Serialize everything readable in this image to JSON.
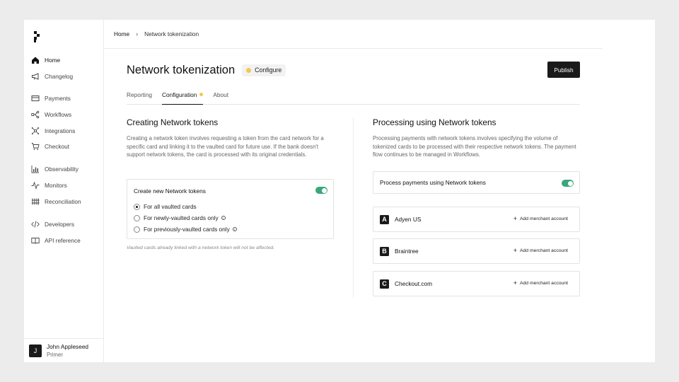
{
  "sidebar": {
    "items": [
      {
        "label": "Home",
        "icon": "home-icon"
      },
      {
        "label": "Changelog",
        "icon": "megaphone-icon"
      },
      {
        "label": "Payments",
        "icon": "card-icon"
      },
      {
        "label": "Workflows",
        "icon": "workflow-icon"
      },
      {
        "label": "Integrations",
        "icon": "integrations-icon"
      },
      {
        "label": "Checkout",
        "icon": "cart-icon"
      },
      {
        "label": "Observability",
        "icon": "bar-chart-icon"
      },
      {
        "label": "Monitors",
        "icon": "pulse-icon"
      },
      {
        "label": "Reconciliation",
        "icon": "reconciliation-icon"
      },
      {
        "label": "Developers",
        "icon": "code-icon"
      },
      {
        "label": "API reference",
        "icon": "book-icon"
      }
    ],
    "user": {
      "initial": "J",
      "name": "John Appleseed",
      "org": "Primer"
    }
  },
  "breadcrumb": {
    "home": "Home",
    "separator": "›",
    "current": "Network tokenization"
  },
  "page": {
    "title": "Network tokenization",
    "badge": "Configure",
    "publish_label": "Publish",
    "tabs": [
      {
        "label": "Reporting"
      },
      {
        "label": "Configuration"
      },
      {
        "label": "About"
      }
    ]
  },
  "creating": {
    "title": "Creating Network tokens",
    "description": "Creating a network token involves requesting a token from the card network for a specific card and linking it to the vaulted card for future use. If the bank doesn't support network tokens, the card is processed with its original credentials.",
    "card_title": "Create new Network tokens",
    "options": [
      {
        "label": "For all vaulted cards",
        "selected": true
      },
      {
        "label": "For newly-vaulted cards only",
        "selected": false
      },
      {
        "label": "For previously-vaulted cards only",
        "selected": false
      }
    ],
    "info_glyph": "i",
    "note": "Vaulted cards already linked with a network token will not be affected."
  },
  "processing": {
    "title": "Processing using Network tokens",
    "description": "Processing payments with network tokens involves specifying the volume of tokenized cards to be processed with their respective network tokens. The payment flow continues to be managed in Workflows.",
    "toggle_label": "Process payments using Network tokens",
    "add_glyph": "+",
    "providers": [
      {
        "logo": "A",
        "name": "Adyen US",
        "action": "Add merchant account"
      },
      {
        "logo": "B",
        "name": "Braintree",
        "action": "Add merchant account"
      },
      {
        "logo": "C",
        "name": "Checkout.com",
        "action": "Add merchant account"
      }
    ]
  },
  "colors": {
    "accent_toggle": "#3aa77a",
    "badge_dot": "#f2c94c",
    "primary_button": "#1a1a1a"
  }
}
